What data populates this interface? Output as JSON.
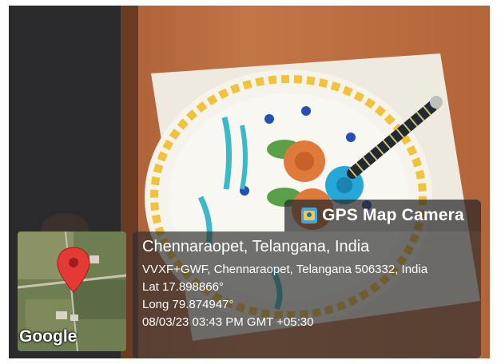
{
  "watermark": {
    "app_name": "GPS Map Camera",
    "icon": "gps-map-camera-icon"
  },
  "location": {
    "title": "Chennaraopet, Telangana, India",
    "address": "VVXF+GWF, Chennaraopet, Telangana 506332, India",
    "lat": "Lat 17.898866°",
    "long": "Long 79.874947°",
    "datetime": "08/03/23 03:43 PM GMT +05:30"
  },
  "map": {
    "logo_text": "Google",
    "pin_icon": "map-pin-icon",
    "pin_color": "#e53935"
  },
  "colors": {
    "panel": "#2d2d2d",
    "cake_icing": "#f4f1ea",
    "cake_lettering": "#3ab9c9",
    "piping_yellow": "#f2c23a"
  }
}
